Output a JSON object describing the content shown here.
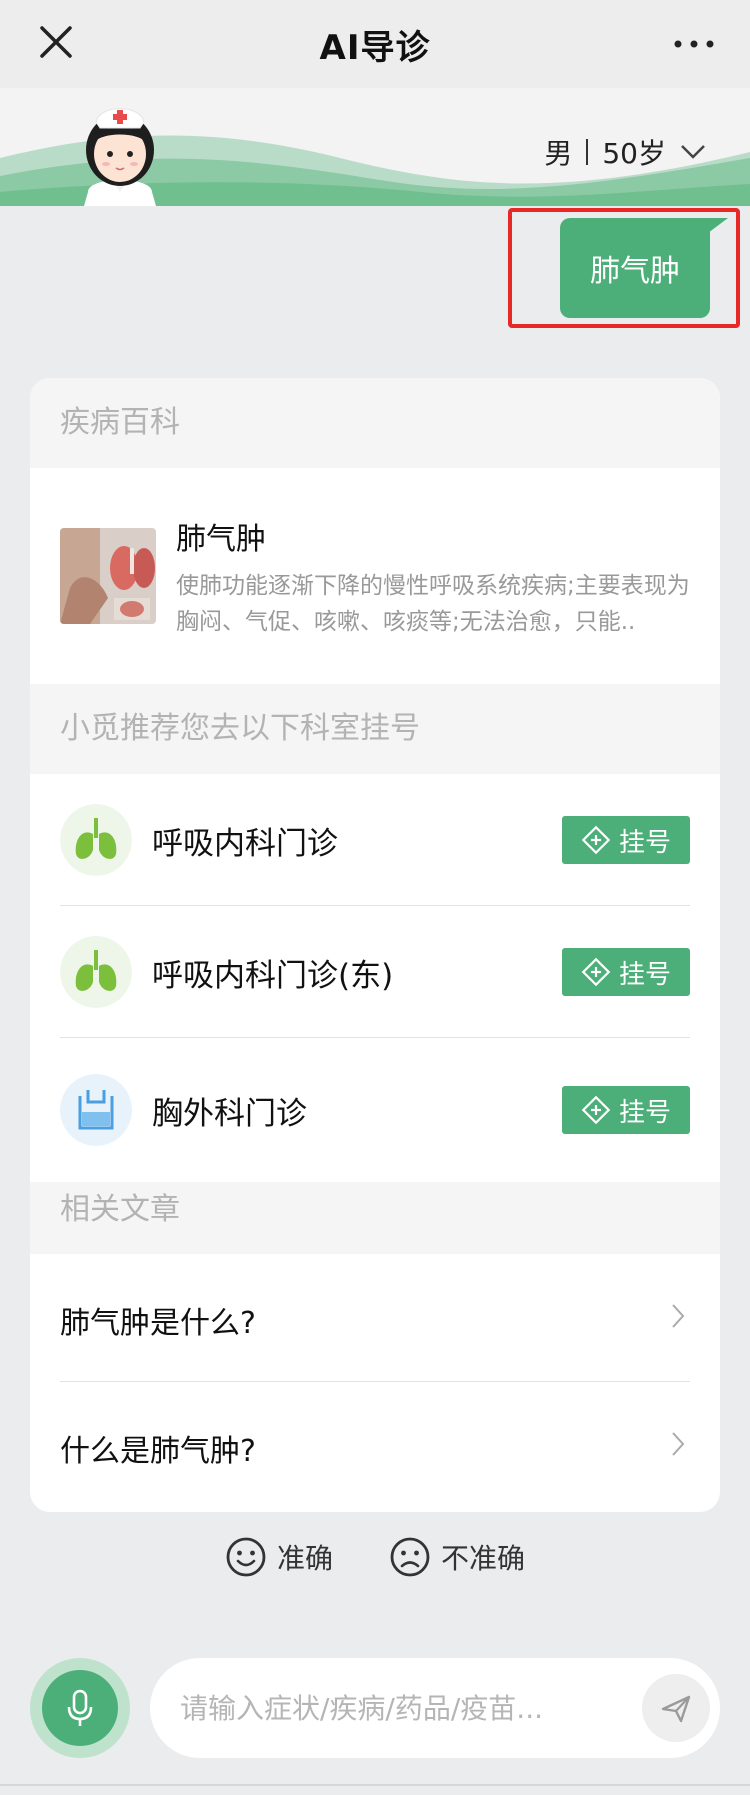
{
  "header": {
    "title": "AI导诊",
    "profile_gender": "男",
    "profile_age": "50岁"
  },
  "chat": {
    "user_message": "肺气肿"
  },
  "card": {
    "encyclopedia_header": "疾病百科",
    "disease": {
      "name": "肺气肿",
      "description": "使肺功能逐渐下降的慢性呼吸系统疾病;主要表现为胸闷、气促、咳嗽、咳痰等;无法治愈，只能.."
    },
    "departments_header": "小觅推荐您去以下科室挂号",
    "departments": [
      {
        "name": "呼吸内科门诊",
        "button": "挂号"
      },
      {
        "name": "呼吸内科门诊(东)",
        "button": "挂号"
      },
      {
        "name": "胸外科门诊",
        "button": "挂号"
      }
    ],
    "articles_header": "相关文章",
    "articles": [
      {
        "title": "肺气肿是什么?"
      },
      {
        "title": "什么是肺气肿?"
      }
    ]
  },
  "feedback": {
    "accurate": "准确",
    "inaccurate": "不准确"
  },
  "input": {
    "placeholder": "请输入症状/疾病/药品/疫苗..."
  },
  "colors": {
    "accent": "#4caf79",
    "highlight_border": "#e82727"
  }
}
